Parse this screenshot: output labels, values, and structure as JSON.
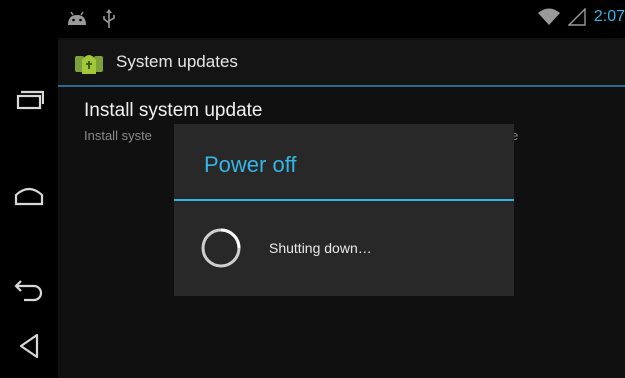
{
  "status_bar": {
    "clock": "2:07",
    "notification_icons": [
      "android-debug-icon",
      "usb-icon"
    ],
    "system_icons": [
      "wifi-icon",
      "signal-icon"
    ]
  },
  "navigation": {
    "buttons": [
      "recents-button",
      "home-button",
      "back-button",
      "menu-button"
    ]
  },
  "action_bar": {
    "title": "System updates",
    "icon": "system-update-app-icon"
  },
  "preference": {
    "title": "Install system update",
    "summary_left": "Install syste",
    "summary_right": "rage"
  },
  "dialog": {
    "title": "Power off",
    "message": "Shutting down…"
  },
  "colors": {
    "accent": "#35b5e5",
    "background": "#000000",
    "dialog_background": "#282828"
  }
}
